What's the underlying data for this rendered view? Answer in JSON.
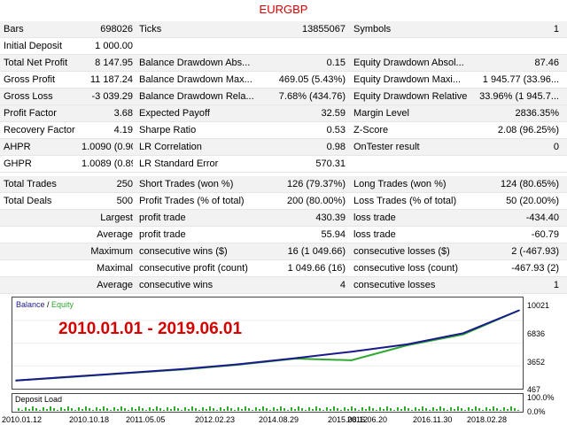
{
  "title": "EURGBP",
  "rows": [
    {
      "cells": [
        "Bars",
        "698026",
        "Ticks",
        "13855067",
        "Symbols",
        "1"
      ]
    },
    {
      "cells": [
        "Initial Deposit",
        "1 000.00",
        "",
        "",
        "",
        ""
      ]
    },
    {
      "cells": [
        "Total Net Profit",
        "8 147.95",
        "Balance Drawdown Abs...",
        "0.15",
        "Equity Drawdown Absol...",
        "87.46"
      ]
    },
    {
      "cells": [
        "Gross Profit",
        "11 187.24",
        "Balance Drawdown Max...",
        "469.05 (5.43%)",
        "Equity Drawdown Maxi...",
        "1 945.77 (33.96..."
      ]
    },
    {
      "cells": [
        "Gross Loss",
        "-3 039.29",
        "Balance Drawdown Rela...",
        "7.68% (434.76)",
        "Equity Drawdown Relative",
        "33.96% (1 945.7..."
      ]
    },
    {
      "cells": [
        "Profit Factor",
        "3.68",
        "Expected Payoff",
        "32.59",
        "Margin Level",
        "2836.35%"
      ]
    },
    {
      "cells": [
        "Recovery Factor",
        "4.19",
        "Sharpe Ratio",
        "0.53",
        "Z-Score",
        "2.08 (96.25%)"
      ]
    },
    {
      "cells": [
        "AHPR",
        "1.0090 (0.90%)",
        "LR Correlation",
        "0.98",
        "OnTester result",
        "0"
      ]
    },
    {
      "cells": [
        "GHPR",
        "1.0089 (0.89%)",
        "LR Standard Error",
        "570.31",
        "",
        ""
      ]
    },
    {
      "cells": [
        "Total Trades",
        "250",
        "Short Trades (won %)",
        "126 (79.37%)",
        "Long Trades (won %)",
        "124 (80.65%)"
      ]
    },
    {
      "cells": [
        "Total Deals",
        "500",
        "Profit Trades (% of total)",
        "200 (80.00%)",
        "Loss Trades (% of total)",
        "50 (20.00%)"
      ]
    },
    {
      "cells": [
        "Largest",
        "",
        "profit trade",
        "430.39",
        "loss trade",
        "-434.40"
      ]
    },
    {
      "cells": [
        "Average",
        "",
        "profit trade",
        "55.94",
        "loss trade",
        "-60.79"
      ]
    },
    {
      "cells": [
        "Maximum",
        "",
        "consecutive wins ($)",
        "16 (1 049.66)",
        "consecutive losses ($)",
        "2 (-467.93)"
      ]
    },
    {
      "cells": [
        "Maximal",
        "",
        "consecutive profit (count)",
        "1 049.66 (16)",
        "consecutive loss (count)",
        "-467.93 (2)"
      ]
    },
    {
      "cells": [
        "Average",
        "",
        "consecutive wins",
        "4",
        "consecutive losses",
        "1"
      ]
    }
  ],
  "chart": {
    "legend_balance": "Balance",
    "legend_sep": " / ",
    "legend_equity": "Equity",
    "overlay_text": "2010.01.01 - 2019.06.01",
    "y_labels": [
      "10021",
      "6836",
      "3652",
      "467"
    ],
    "deposit_label": "Deposit Load",
    "deposit_y_labels": [
      "100.0%",
      "0.0%"
    ],
    "x_labels": [
      "2010.01.12",
      "2010.10.18",
      "2011.05.05",
      "2012.02.23",
      "2014.08.29",
      "2015.08.12",
      "2016.06.20",
      "2016.11.30",
      "2018.02.28"
    ],
    "balance_color": "#1a1a8c",
    "equity_color": "#2ea82e"
  },
  "chart_data": {
    "type": "line",
    "x": [
      "2010.01.12",
      "2010.10.18",
      "2011.05.05",
      "2012.02.23",
      "2014.08.29",
      "2015.08.12",
      "2016.06.20",
      "2016.11.30",
      "2018.02.28",
      "2019.06.01"
    ],
    "series": [
      {
        "name": "Balance",
        "values": [
          1000,
          1450,
          1900,
          2350,
          2900,
          3600,
          4350,
          5200,
          6500,
          9148
        ]
      },
      {
        "name": "Equity",
        "values": [
          1000,
          1420,
          1860,
          2300,
          2850,
          3550,
          3350,
          5100,
          6350,
          9148
        ]
      }
    ],
    "ylim": [
      467,
      10021
    ]
  }
}
